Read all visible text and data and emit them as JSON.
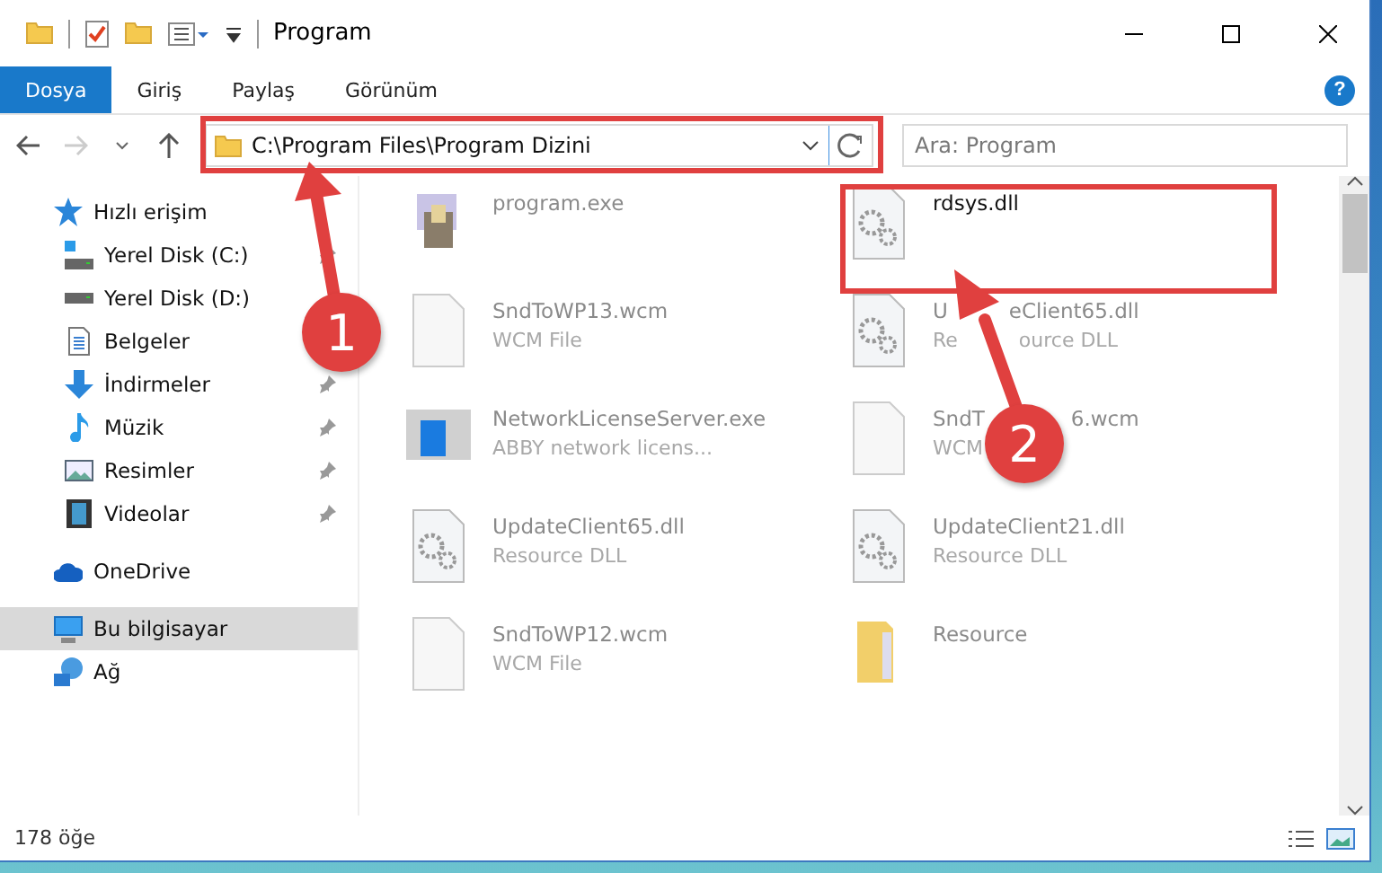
{
  "window": {
    "title": "Program"
  },
  "ribbon": {
    "tabs": [
      {
        "label": "Dosya",
        "selected": true
      },
      {
        "label": "Giriş",
        "selected": false
      },
      {
        "label": "Paylaş",
        "selected": false
      },
      {
        "label": "Görünüm",
        "selected": false
      }
    ],
    "help": "?"
  },
  "address": {
    "path": "C:\\Program Files\\Program Dizini"
  },
  "search": {
    "placeholder": "Ara: Program"
  },
  "nav_pane": [
    {
      "label": "Hızlı erişim",
      "kind": "star",
      "selected": false,
      "children": [
        {
          "label": "Yerel Disk (C:)",
          "kind": "drive-c",
          "pinned": true,
          "selected": false
        },
        {
          "label": "Yerel Disk (D:)",
          "kind": "drive",
          "pinned": false,
          "selected": false
        },
        {
          "label": "Belgeler",
          "kind": "doc",
          "pinned": false,
          "selected": false
        },
        {
          "label": "İndirmeler",
          "kind": "download",
          "pinned": true,
          "selected": false
        },
        {
          "label": "Müzik",
          "kind": "music",
          "pinned": true,
          "selected": false
        },
        {
          "label": "Resimler",
          "kind": "image",
          "pinned": true,
          "selected": false
        },
        {
          "label": "Videolar",
          "kind": "video",
          "pinned": true,
          "selected": false
        }
      ]
    },
    {
      "label": "OneDrive",
      "kind": "cloud",
      "selected": false
    },
    {
      "label": "Bu bilgisayar",
      "kind": "pc",
      "selected": true
    },
    {
      "label": "Ağ",
      "kind": "network",
      "selected": false
    }
  ],
  "files": [
    {
      "name": [
        "program.exe"
      ],
      "kind": "exe",
      "selected": false
    },
    {
      "name": [
        "rdsys.dll"
      ],
      "kind": "dll",
      "selected": true
    },
    {
      "name": [
        "SndToWP13.wcm"
      ],
      "type": [
        "WCM File"
      ],
      "kind": "file",
      "selected": false
    },
    {
      "name": [
        "U",
        "eClient65.dll"
      ],
      "type": [
        "Re",
        "ource DLL"
      ],
      "kind": "dll",
      "selected": false
    },
    {
      "name": [
        "NetworkLicenseServer.exe"
      ],
      "type": [
        "ABBY network licens..."
      ],
      "kind": "app",
      "selected": false
    },
    {
      "name": [
        "SndT",
        "6.wcm"
      ],
      "type": [
        "WCM"
      ],
      "kind": "file",
      "selected": false
    },
    {
      "name": [
        "UpdateClient65.dll"
      ],
      "type": [
        "Resource DLL"
      ],
      "kind": "dll",
      "selected": false
    },
    {
      "name": [
        "UpdateClient21.dll"
      ],
      "type": [
        "Resource DLL"
      ],
      "kind": "dll",
      "selected": false
    },
    {
      "name": [
        "SndToWP12.wcm"
      ],
      "type": [
        "WCM File"
      ],
      "kind": "file",
      "selected": false
    },
    {
      "name": [
        "Resource"
      ],
      "kind": "folder",
      "selected": false
    }
  ],
  "status_bar": {
    "count": "178 öğe"
  },
  "annotations": [
    {
      "kind": "box"
    },
    {
      "kind": "box"
    },
    {
      "kind": "marker",
      "label": "1"
    },
    {
      "kind": "marker",
      "label": "2"
    }
  ]
}
